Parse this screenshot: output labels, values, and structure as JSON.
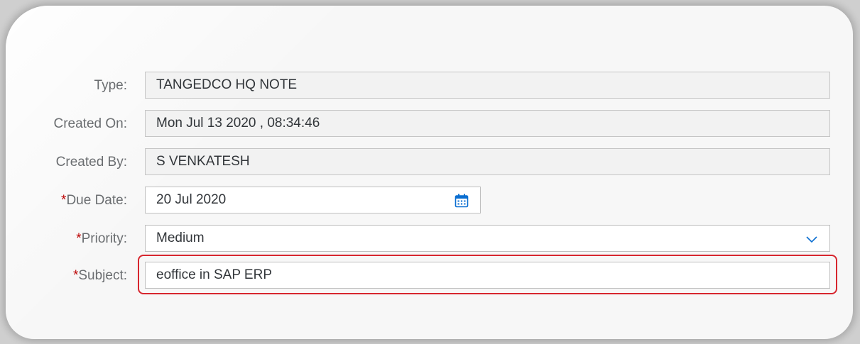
{
  "form": {
    "type": {
      "label": "Type:",
      "value": "TANGEDCO HQ NOTE"
    },
    "created_on": {
      "label": "Created On:",
      "value": "Mon Jul 13 2020 , 08:34:46"
    },
    "created_by": {
      "label": "Created By:",
      "value": "S VENKATESH"
    },
    "due_date": {
      "required_mark": "*",
      "label": "Due Date:",
      "value": "20 Jul 2020"
    },
    "priority": {
      "required_mark": "*",
      "label": "Priority:",
      "value": "Medium"
    },
    "subject": {
      "required_mark": "*",
      "label": "Subject:",
      "value": "eoffice in SAP ERP"
    }
  },
  "icons": {
    "calendar": "calendar-icon",
    "dropdown": "chevron-down-icon"
  },
  "colors": {
    "required": "#bb0000",
    "highlight": "#d7262e",
    "label": "#6a6d70",
    "accent": "#0a6ed1"
  }
}
